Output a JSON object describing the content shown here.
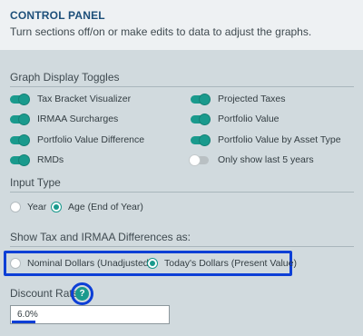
{
  "header": {
    "title": "CONTROL PANEL",
    "subtitle": "Turn sections off/on or make edits to data to adjust the graphs."
  },
  "graph_toggles": {
    "title": "Graph Display Toggles",
    "items": [
      {
        "label": "Tax Bracket Visualizer",
        "on": true
      },
      {
        "label": "Projected Taxes",
        "on": true
      },
      {
        "label": "IRMAA Surcharges",
        "on": true
      },
      {
        "label": "Portfolio Value",
        "on": true
      },
      {
        "label": "Portfolio Value Difference",
        "on": true
      },
      {
        "label": "Portfolio Value by Asset Type",
        "on": true
      },
      {
        "label": "RMDs",
        "on": true
      },
      {
        "label": "Only show last 5 years",
        "on": false
      }
    ]
  },
  "input_type": {
    "title": "Input Type",
    "options": [
      {
        "label": "Year",
        "selected": false
      },
      {
        "label": "Age (End of Year)",
        "selected": true
      }
    ]
  },
  "differences": {
    "title": "Show Tax and IRMAA Differences as:",
    "options": [
      {
        "label": "Nominal Dollars (Unadjusted)",
        "selected": false
      },
      {
        "label": "Today's Dollars (Present Value)",
        "selected": true
      }
    ]
  },
  "discount_rate": {
    "label": "Discount Rate",
    "help_icon": "?",
    "value": "6.0%"
  },
  "colors": {
    "accent": "#1a9a8d",
    "highlight": "#0d3fd6",
    "title": "#1d4f7a",
    "background": "#d1dade"
  }
}
